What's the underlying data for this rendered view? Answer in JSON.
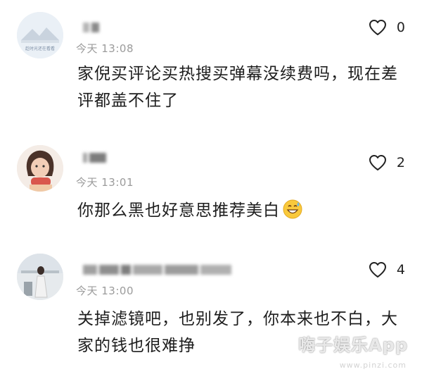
{
  "comments": [
    {
      "username": "",
      "avatar_caption": "趁时光还在看看",
      "time": "今天 13:08",
      "text": "家倪买评论买热搜买弹幕没续费吗，现在差评都盖不住了",
      "likes": "0",
      "avatar": "landscape-avatar"
    },
    {
      "username": "",
      "time": "今天 13:01",
      "text": "你那么黑也好意思推荐美白",
      "emoji": "grinning-sweat-emoji",
      "likes": "2",
      "avatar": "girl-avatar"
    },
    {
      "username": "",
      "time": "今天 13:00",
      "text": "关掉滤镜吧，也别发了，你本来也不白，大家的钱也很难挣",
      "likes": "4",
      "avatar": "photo-avatar"
    }
  ],
  "watermark": {
    "brand": "嗨子娱乐App",
    "url": "www.pinzi.com"
  },
  "colors": {
    "text": "#1d1d1d",
    "meta": "#9b9b9b",
    "icon": "#222222"
  }
}
